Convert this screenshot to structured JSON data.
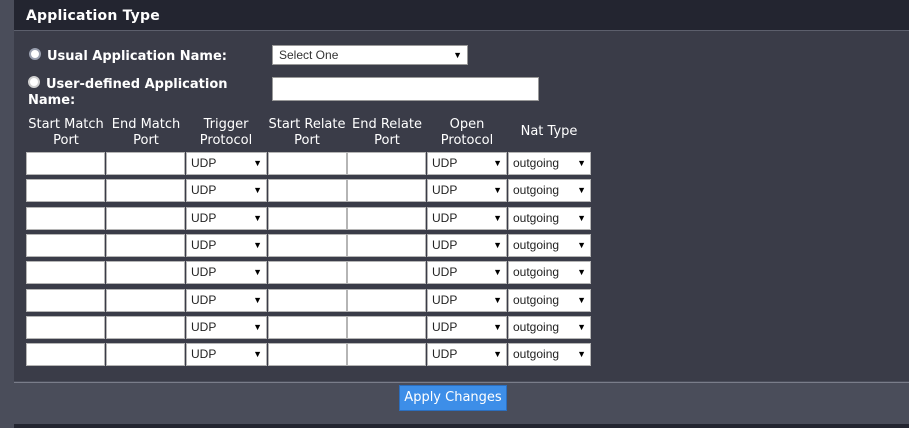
{
  "section": {
    "title": "Application Type"
  },
  "usual_app": {
    "label": "Usual Application Name:",
    "select_value": "Select One"
  },
  "user_app": {
    "label": "User-defined Application Name:",
    "value": ""
  },
  "table": {
    "headers": {
      "start_match": "Start Match Port",
      "end_match": "End Match Port",
      "trigger": "Trigger Protocol",
      "start_relate": "Start Relate Port",
      "end_relate": "End Relate Port",
      "open": "Open Protocol",
      "nat": "Nat Type"
    },
    "rows": [
      {
        "trigger": "UDP",
        "open": "UDP",
        "nat": "outgoing"
      },
      {
        "trigger": "UDP",
        "open": "UDP",
        "nat": "outgoing"
      },
      {
        "trigger": "UDP",
        "open": "UDP",
        "nat": "outgoing"
      },
      {
        "trigger": "UDP",
        "open": "UDP",
        "nat": "outgoing"
      },
      {
        "trigger": "UDP",
        "open": "UDP",
        "nat": "outgoing"
      },
      {
        "trigger": "UDP",
        "open": "UDP",
        "nat": "outgoing"
      },
      {
        "trigger": "UDP",
        "open": "UDP",
        "nat": "outgoing"
      },
      {
        "trigger": "UDP",
        "open": "UDP",
        "nat": "outgoing"
      }
    ]
  },
  "apply_label": "Apply Changes",
  "colors": {
    "panel": "#4a4d5a",
    "title_bar": "#232530",
    "button": "#3d8ee8"
  }
}
